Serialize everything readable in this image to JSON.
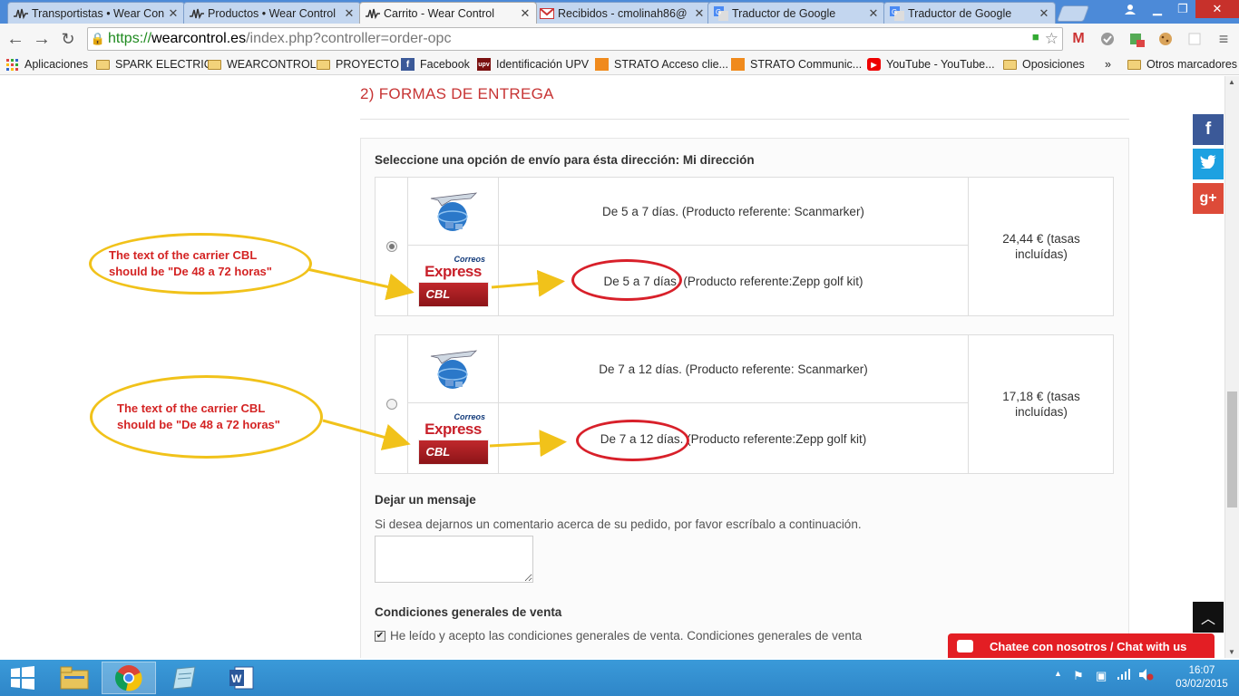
{
  "browser": {
    "tabs": [
      {
        "label": "Transportistas • Wear Con",
        "favicon": "wearcontrol-icon"
      },
      {
        "label": "Productos • Wear Control",
        "favicon": "wearcontrol-icon"
      },
      {
        "label": "Carrito - Wear Control",
        "favicon": "wearcontrol-icon",
        "active": true
      },
      {
        "label": "Recibidos - cmolinah86@",
        "favicon": "gmail-icon"
      },
      {
        "label": "Traductor de Google",
        "favicon": "google-translate-icon"
      },
      {
        "label": "Traductor de Google",
        "favicon": "google-translate-icon"
      }
    ],
    "url": {
      "scheme": "https://",
      "host": "wearcontrol.es",
      "path": "/index.php?controller=order-opc"
    },
    "bookmarks": [
      {
        "label": "Aplicaciones",
        "icon": "apps-grid-icon"
      },
      {
        "label": "SPARK ELECTRIC",
        "icon": "folder-icon"
      },
      {
        "label": "WEARCONTROL",
        "icon": "folder-icon"
      },
      {
        "label": "PROYECTO",
        "icon": "folder-icon"
      },
      {
        "label": "Facebook",
        "icon": "facebook-icon"
      },
      {
        "label": "Identificación UPV",
        "icon": "upv-icon"
      },
      {
        "label": "STRATO Acceso clie...",
        "icon": "strato-icon"
      },
      {
        "label": "STRATO Communic...",
        "icon": "strato-icon"
      },
      {
        "label": "YouTube - YouTube...",
        "icon": "youtube-icon"
      },
      {
        "label": "Oposiciones",
        "icon": "folder-icon"
      },
      {
        "label": "»",
        "icon": ""
      },
      {
        "label": "Otros marcadores",
        "icon": "folder-icon"
      }
    ]
  },
  "page": {
    "section_title": "2)  FORMAS DE ENTREGA",
    "carrier_heading": "Seleccione una opción de envío para ésta dirección: Mi dirección",
    "delivery_options": [
      {
        "selected": true,
        "line1": "De 5 a 7 días. (Producto referente: Scanmarker)",
        "line2": "De 5 a 7 días. (Producto referente:Zepp golf kit)",
        "price": "24,44 € (tasas incluídas)"
      },
      {
        "selected": false,
        "line1": "De 7 a 12 días. (Producto referente: Scanmarker)",
        "line2": "De 7 a 12 días. (Producto referente:Zepp golf kit)",
        "price": "17,18 € (tasas incluídas)"
      }
    ],
    "logos": {
      "correos": "Correos",
      "express": "Express",
      "cbl": "CBL"
    },
    "message": {
      "heading": "Dejar un mensaje",
      "subtext": "Si desea dejarnos un comentario acerca de su pedido, por favor escríbalo a continuación.",
      "value": ""
    },
    "conditions": {
      "heading": "Condiciones generales de venta",
      "checkbox_label": "He leído y acepto las condiciones generales de venta.",
      "link": "Condiciones generales de venta",
      "checked": true
    },
    "chat_label": "Chatee con nosotros / Chat with us",
    "social": {
      "facebook": "f",
      "twitter": "t",
      "googleplus": "g+"
    }
  },
  "annotations": [
    {
      "line1": "The text of the carrier CBL",
      "line2": "should be \"De 48 a 72 horas\""
    },
    {
      "line1": "The text of the carrier CBL",
      "line2": "should be \"De 48 a 72 horas\""
    }
  ],
  "taskbar": {
    "apps": [
      "windows-start-icon",
      "file-explorer-icon",
      "chrome-icon",
      "notepad-icon",
      "word-icon"
    ],
    "time": "16:07",
    "date": "03/02/2015"
  },
  "colors": {
    "section_title": "#c73434",
    "annotation_outline": "#f1c21a",
    "annotation_text": "#d42424",
    "highlight_circle": "#d8202a",
    "chat": "#e31e24"
  }
}
